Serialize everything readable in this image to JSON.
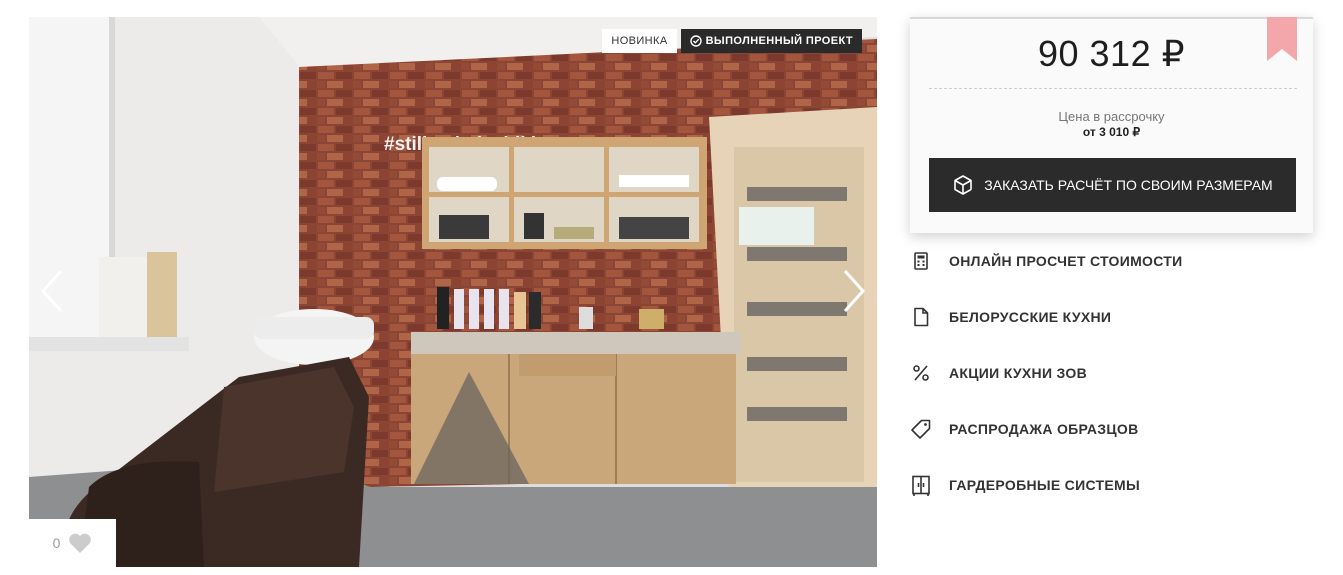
{
  "gallery": {
    "badges": {
      "new": "НОВИНКА",
      "done": "ВЫПОЛНЕННЫЙ ПРОЕКТ"
    },
    "wall_text": "#stilist_balashikha",
    "likes": "0"
  },
  "price": {
    "amount": "90 312 ₽",
    "installment_label": "Цена в рассрочку",
    "installment_value": "от 3 010 ₽",
    "order_button": "ЗАКАЗАТЬ РАСЧЁТ ПО СВОИМ РАЗМЕРАМ"
  },
  "links": [
    {
      "label": "ОНЛАЙН ПРОСЧЕТ СТОИМОСТИ",
      "icon": "calculator-icon"
    },
    {
      "label": "БЕЛОРУССКИЕ КУХНИ",
      "icon": "document-icon"
    },
    {
      "label": "АКЦИИ КУХНИ ЗОВ",
      "icon": "percent-icon"
    },
    {
      "label": "РАСПРОДАЖА ОБРАЗЦОВ",
      "icon": "tag-icon"
    },
    {
      "label": "ГАРДЕРОБНЫЕ СИСТЕМЫ",
      "icon": "wardrobe-icon"
    }
  ],
  "colors": {
    "accent_ribbon": "#f4a7ab",
    "button": "#2b2b2b"
  }
}
